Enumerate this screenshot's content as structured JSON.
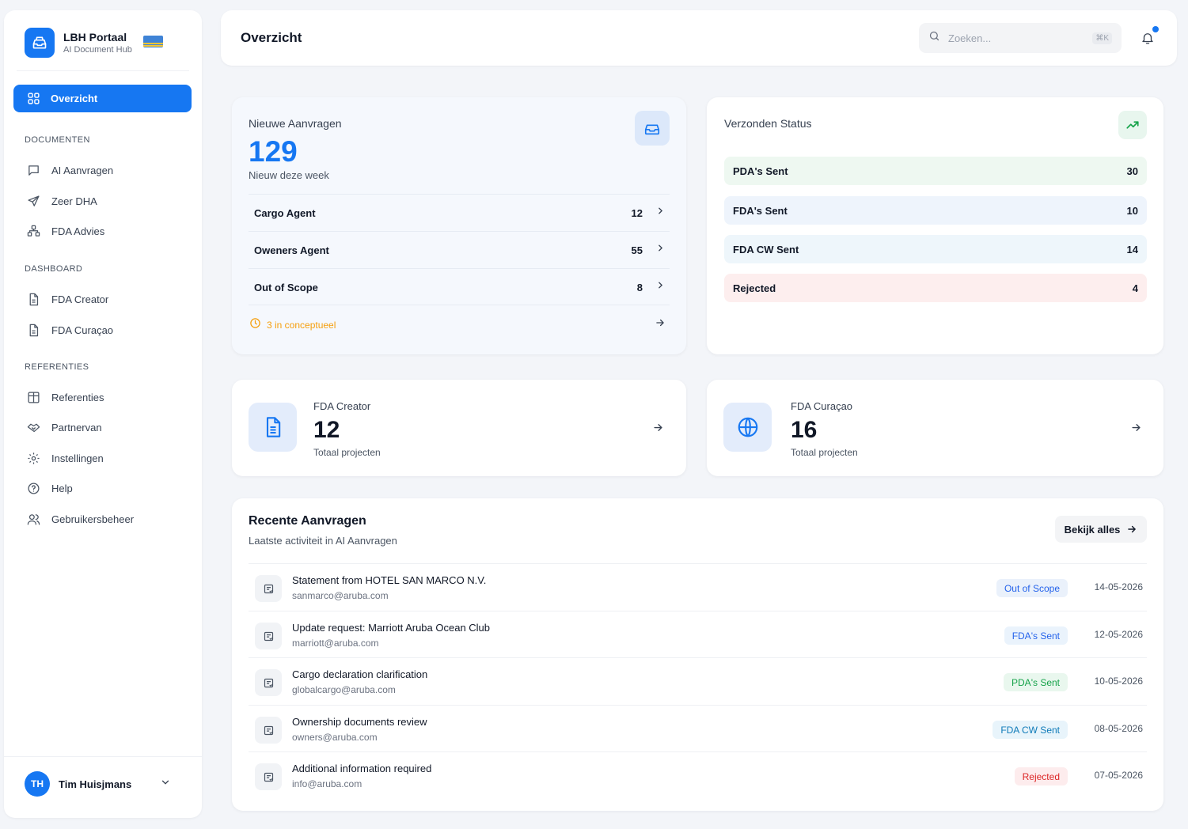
{
  "brand": {
    "title": "LBH Portaal",
    "subtitle": "AI Document Hub"
  },
  "sidebar": {
    "active": {
      "label": "Overzicht",
      "icon": "grid-icon"
    },
    "sections": [
      {
        "title": "DOCUMENTEN",
        "items": [
          {
            "label": "AI Aanvragen",
            "icon": "message-square-icon"
          },
          {
            "label": "Zeer DHA",
            "icon": "send-icon"
          },
          {
            "label": "FDA Advies",
            "icon": "workflow-icon"
          }
        ]
      },
      {
        "title": "DASHBOARD",
        "items": [
          {
            "label": "FDA Creator",
            "icon": "file-text-icon"
          },
          {
            "label": "FDA Curaçao",
            "icon": "file-text-icon"
          }
        ]
      },
      {
        "title": "REFERENTIES",
        "items": [
          {
            "label": "Referenties",
            "icon": "table-icon"
          },
          {
            "label": "Partnervan",
            "icon": "handshake-icon"
          },
          {
            "label": "Instellingen",
            "icon": "gear-icon"
          },
          {
            "label": "Help",
            "icon": "help-circle-icon"
          },
          {
            "label": "Gebruikersbeheer",
            "icon": "users-icon"
          }
        ]
      }
    ],
    "user": {
      "initials": "TH",
      "name": "Tim Huisjmans"
    }
  },
  "header": {
    "title": "Overzicht",
    "search_placeholder": "Zoeken...",
    "shortcut": "⌘K"
  },
  "new_requests": {
    "label": "Nieuwe Aanvragen",
    "value": "129",
    "sublabel": "Nieuw deze week",
    "rows": [
      {
        "label": "Cargo Agent",
        "count": "12"
      },
      {
        "label": "Oweners Agent",
        "count": "55"
      },
      {
        "label": "Out of Scope",
        "count": "8"
      }
    ],
    "footer": "3 in conceptueel",
    "colors": {
      "accent": "#1677f2",
      "warning": "#f59e0b"
    }
  },
  "sent_status": {
    "label": "Verzonden Status",
    "rows": [
      {
        "label": "PDA's Sent",
        "count": "30",
        "bg": "#eef8f1"
      },
      {
        "label": "FDA's Sent",
        "count": "10",
        "bg": "#eef4fc"
      },
      {
        "label": "FDA CW Sent",
        "count": "14",
        "bg": "#eef6fb"
      },
      {
        "label": "Rejected",
        "count": "4",
        "bg": "#fdeeee"
      }
    ]
  },
  "fda_creator": {
    "label": "FDA Creator",
    "value": "12",
    "sublabel": "Totaal projecten"
  },
  "fda_curacao": {
    "label": "FDA Curaçao",
    "value": "16",
    "sublabel": "Totaal projecten"
  },
  "recent": {
    "title": "Recente Aanvragen",
    "subtitle": "Laatste activiteit in AI Aanvragen",
    "view_all": "Bekijk alles",
    "rows": [
      {
        "subject": "Statement from HOTEL SAN MARCO N.V.",
        "email": "sanmarco@aruba.com",
        "status": "Out of Scope",
        "date": "14-05-2026",
        "badge_bg": "#eaf1fb",
        "badge_fg": "#2563eb"
      },
      {
        "subject": "Update request: Marriott Aruba Ocean Club",
        "email": "marriott@aruba.com",
        "status": "FDA's Sent",
        "date": "12-05-2026",
        "badge_bg": "#eaf3fc",
        "badge_fg": "#2563eb"
      },
      {
        "subject": "Cargo declaration clarification",
        "email": "globalcargo@aruba.com",
        "status": "PDA's Sent",
        "date": "10-05-2026",
        "badge_bg": "#e9f7ee",
        "badge_fg": "#16a34a"
      },
      {
        "subject": "Ownership documents review",
        "email": "owners@aruba.com",
        "status": "FDA CW Sent",
        "date": "08-05-2026",
        "badge_bg": "#e8f4fb",
        "badge_fg": "#0e7ab8"
      },
      {
        "subject": "Additional information required",
        "email": "info@aruba.com",
        "status": "Rejected",
        "date": "07-05-2026",
        "badge_bg": "#fdeced",
        "badge_fg": "#dc2626"
      }
    ]
  }
}
